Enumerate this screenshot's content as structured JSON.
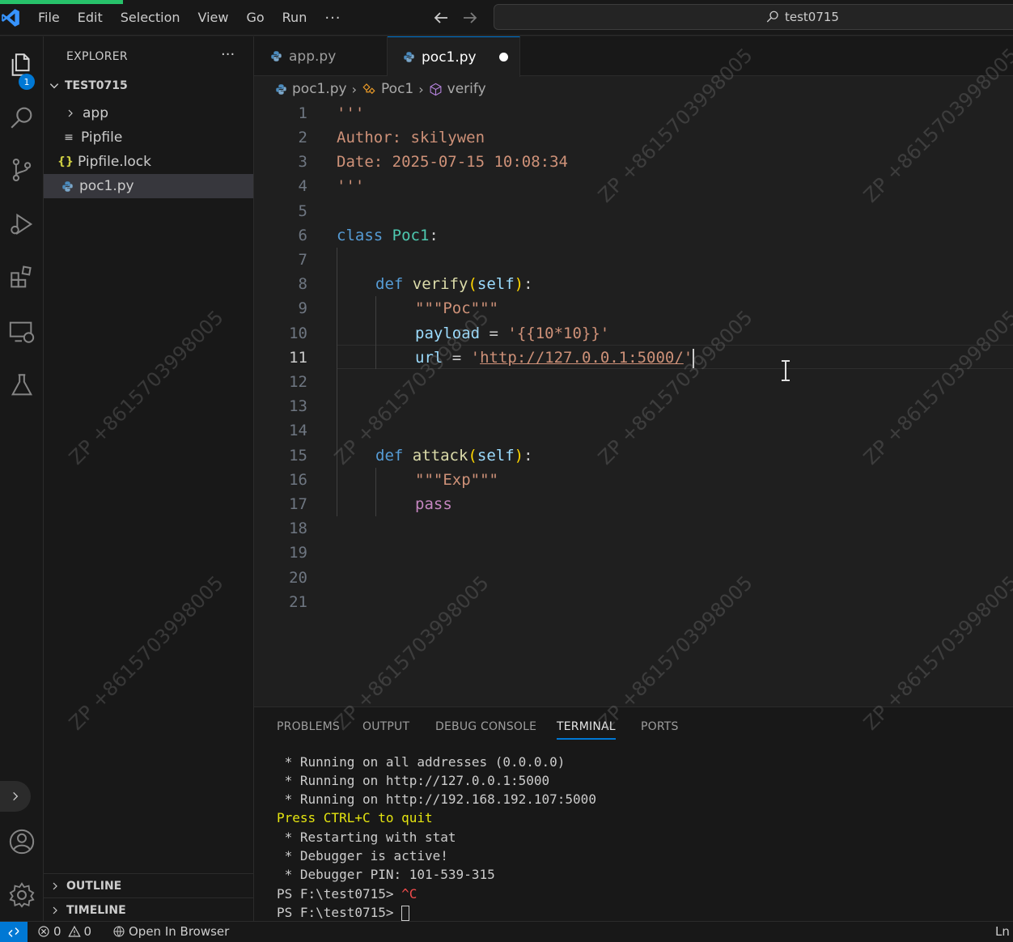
{
  "menu": [
    "File",
    "Edit",
    "Selection",
    "View",
    "Go",
    "Run"
  ],
  "menu_more": "···",
  "command_center": {
    "text": "test0715"
  },
  "activity": {
    "explorer_badge": "1"
  },
  "sidebar": {
    "title": "EXPLORER",
    "more": "···",
    "root": "TEST0715",
    "items": [
      {
        "label": "app",
        "icon": ">"
      },
      {
        "label": "Pipfile",
        "icon": "≡"
      },
      {
        "label": "Pipfile.lock",
        "icon": "{}"
      },
      {
        "label": "poc1.py",
        "icon": "python"
      }
    ],
    "sections": [
      "OUTLINE",
      "TIMELINE"
    ]
  },
  "tabs": [
    {
      "label": "app.py"
    },
    {
      "label": "poc1.py"
    }
  ],
  "breadcrumb": [
    "poc1.py",
    "Poc1",
    "verify"
  ],
  "editor": {
    "line_numbers": [
      "1",
      "2",
      "3",
      "4",
      "5",
      "6",
      "7",
      "8",
      "9",
      "10",
      "11",
      "12",
      "13",
      "14",
      "15",
      "16",
      "17",
      "18",
      "19",
      "20",
      "21"
    ],
    "current_line": "11",
    "l1": "'''",
    "l2": "Author: skilywen",
    "l3": "Date: 2025-07-15 10:08:34",
    "l4": "'''",
    "l6_kw": "class",
    "l6_name": "Poc1",
    "l6_colon": ":",
    "l8_kw": "def",
    "l8_fn": "verify",
    "l8_open": "(",
    "l8_self": "self",
    "l8_close": ")",
    "l8_colon": ":",
    "l9": "\"\"\"Poc\"\"\"",
    "l10_var": "payload",
    "l10_eq": " = ",
    "l10_str": "'{{10*10}}'",
    "l11_var": "url",
    "l11_eq": " = ",
    "l11_q1": "'",
    "l11_url": "http://127.0.0.1:5000/",
    "l11_q2": "'",
    "l15_kw": "def",
    "l15_fn": "attack",
    "l15_open": "(",
    "l15_self": "self",
    "l15_close": ")",
    "l15_colon": ":",
    "l16": "\"\"\"Exp\"\"\"",
    "l17": "pass"
  },
  "panel": {
    "tabs": [
      "PROBLEMS",
      "OUTPUT",
      "DEBUG CONSOLE",
      "TERMINAL",
      "PORTS"
    ],
    "active_tab": "TERMINAL",
    "lines": [
      " * Running on all addresses (0.0.0.0)",
      " * Running on http://127.0.0.1:5000",
      " * Running on http://192.168.192.107:5000",
      "Press CTRL+C to quit",
      " * Restarting with stat",
      " * Debugger is active!",
      " * Debugger PIN: 101-539-315"
    ],
    "prompt1": "PS F:\\test0715> ",
    "ctrl_c": "^C",
    "prompt2": "PS F:\\test0715> "
  },
  "statusbar": {
    "errors": "0",
    "warnings": "0",
    "open_browser": "Open In Browser",
    "right": "Ln"
  },
  "watermark": "ZP +8615703998005",
  "colors": {
    "accent": "#0078d4",
    "progress": "#27c26a",
    "background": "#1f1f1f"
  }
}
